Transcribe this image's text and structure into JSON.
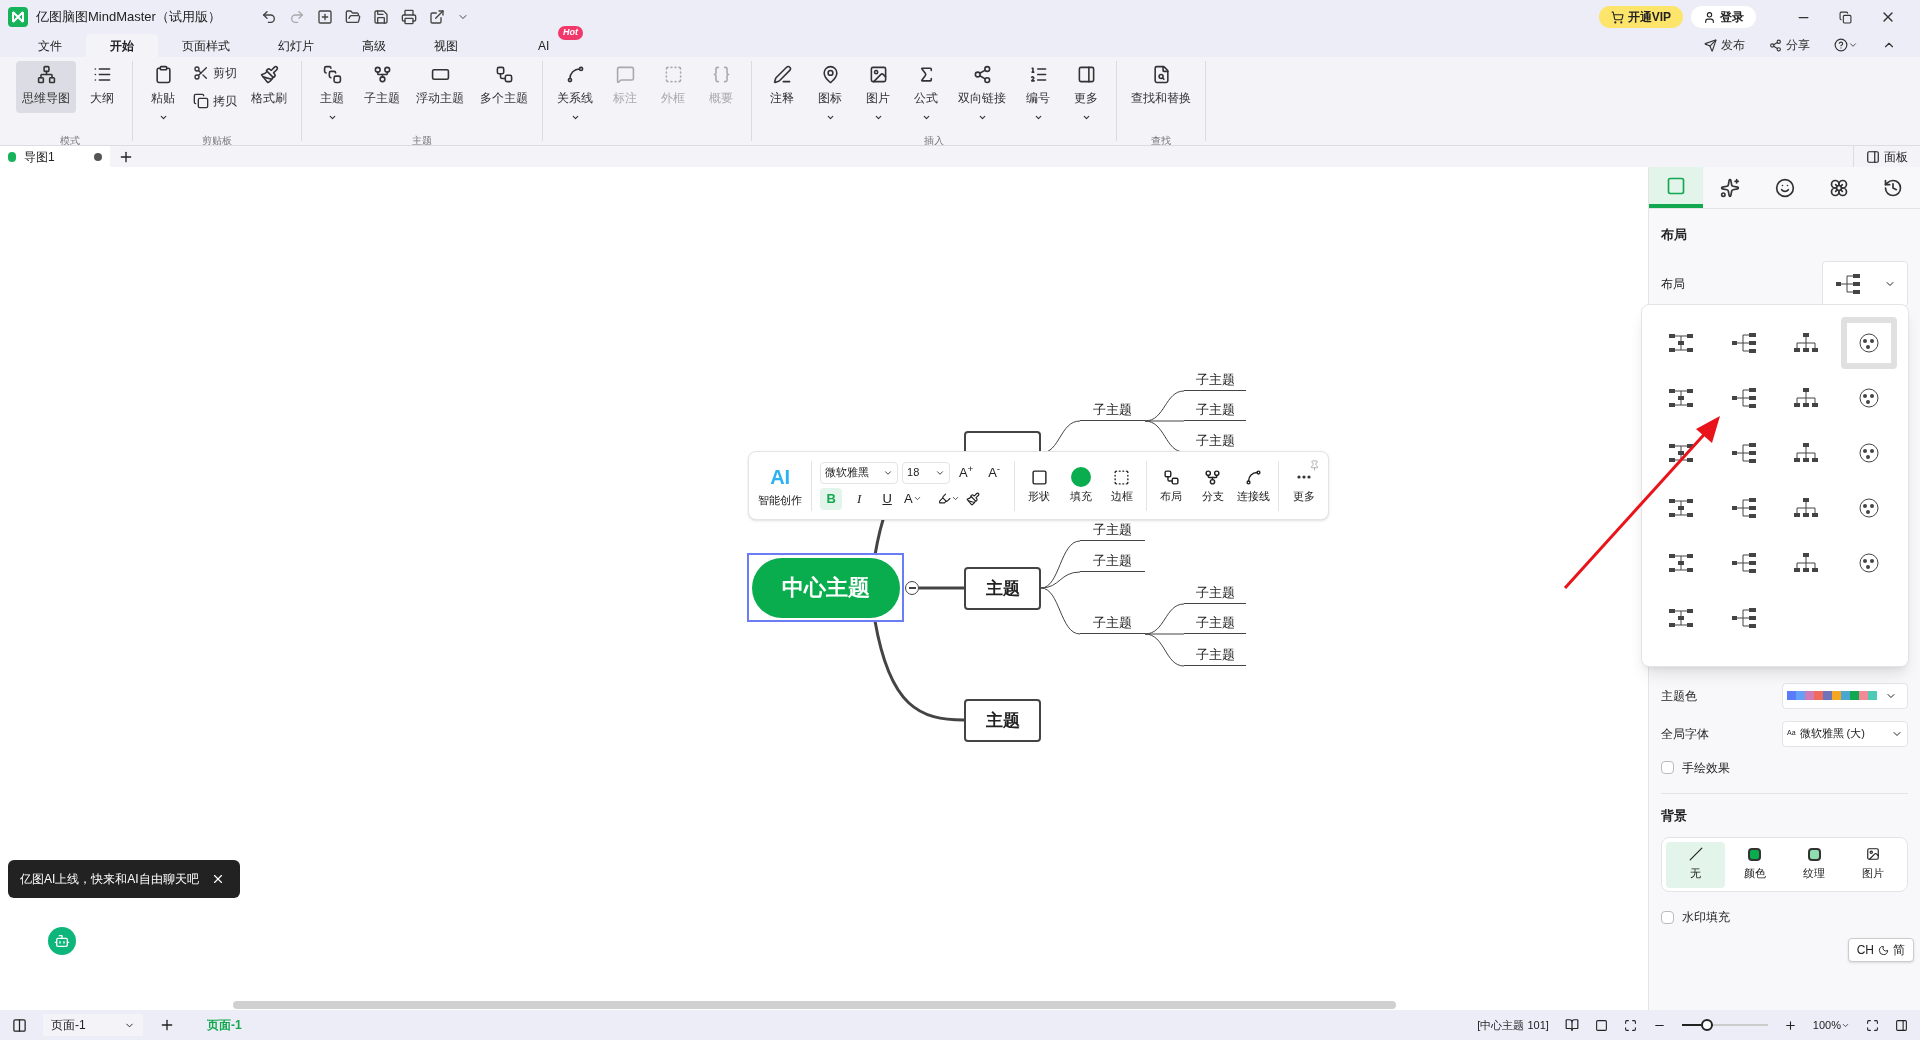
{
  "title_bar": {
    "title": "亿图脑图MindMaster（试用版）",
    "vip": "开通VIP",
    "login": "登录",
    "publish": "发布",
    "share": "分享"
  },
  "menu_tabs": [
    {
      "label": "文件",
      "selected": false
    },
    {
      "label": "开始",
      "selected": true
    },
    {
      "label": "页面样式",
      "selected": false
    },
    {
      "label": "幻灯片",
      "selected": false
    },
    {
      "label": "高级",
      "selected": false
    },
    {
      "label": "视图",
      "selected": false
    },
    {
      "label": "AI",
      "selected": false,
      "badge": "Hot"
    }
  ],
  "ribbon": [
    {
      "label": "模式",
      "items": [
        {
          "kind": "big",
          "label": "思维导图",
          "selected": true,
          "disabled": false,
          "dropdown": false
        },
        {
          "kind": "big",
          "label": "大纲",
          "selected": false,
          "disabled": false,
          "dropdown": false
        }
      ]
    },
    {
      "label": "剪贴板",
      "items": [
        {
          "kind": "big",
          "label": "粘贴",
          "selected": false,
          "disabled": false,
          "dropdown": true
        },
        {
          "kind": "small",
          "label": "剪切",
          "selected": false,
          "disabled": false
        },
        {
          "kind": "small",
          "label": "拷贝",
          "selected": false,
          "disabled": false
        },
        {
          "kind": "big",
          "label": "格式刷",
          "selected": false,
          "disabled": false,
          "dropdown": false
        }
      ]
    },
    {
      "label": "主题",
      "items": [
        {
          "kind": "big",
          "label": "主题",
          "selected": false,
          "disabled": false,
          "dropdown": true
        },
        {
          "kind": "big",
          "label": "子主题",
          "selected": false,
          "disabled": false,
          "dropdown": false
        },
        {
          "kind": "big",
          "label": "浮动主题",
          "selected": false,
          "disabled": false,
          "dropdown": false
        },
        {
          "kind": "big",
          "label": "多个主题",
          "selected": false,
          "disabled": false,
          "dropdown": false
        }
      ]
    },
    {
      "items": [
        {
          "kind": "big",
          "label": "关系线",
          "selected": false,
          "disabled": false,
          "dropdown": true
        },
        {
          "kind": "big",
          "label": "标注",
          "selected": false,
          "disabled": true,
          "dropdown": false
        },
        {
          "kind": "big",
          "label": "外框",
          "selected": false,
          "disabled": true,
          "dropdown": false
        },
        {
          "kind": "big",
          "label": "概要",
          "selected": false,
          "disabled": true,
          "dropdown": false
        }
      ]
    },
    {
      "label": "插入",
      "items": [
        {
          "kind": "big",
          "label": "注释",
          "selected": false,
          "disabled": false,
          "dropdown": false
        },
        {
          "kind": "big",
          "label": "图标",
          "selected": false,
          "disabled": false,
          "dropdown": true
        },
        {
          "kind": "big",
          "label": "图片",
          "selected": false,
          "disabled": false,
          "dropdown": true
        },
        {
          "kind": "big",
          "label": "公式",
          "selected": false,
          "disabled": false,
          "dropdown": true
        },
        {
          "kind": "big",
          "label": "双向链接",
          "selected": false,
          "disabled": false,
          "dropdown": true
        },
        {
          "kind": "big",
          "label": "编号",
          "selected": false,
          "disabled": false,
          "dropdown": true
        },
        {
          "kind": "big",
          "label": "更多",
          "selected": false,
          "disabled": false,
          "dropdown": true
        }
      ]
    },
    {
      "label": "查找",
      "items": [
        {
          "kind": "big",
          "label": "查找和替换",
          "selected": false,
          "disabled": false,
          "dropdown": false
        }
      ]
    }
  ],
  "doc_tabs": [
    {
      "label": "导图1",
      "selected": true,
      "unsaved": true
    }
  ],
  "panel_toggle": "面板",
  "mindmap": {
    "central": "中心主题",
    "topics": [
      {
        "children": [
          {
            "label": "子主题",
            "children": [
              {
                "label": "子主题"
              },
              {
                "label": "子主题"
              },
              {
                "label": "子主题"
              }
            ]
          }
        ]
      },
      {
        "label": "主题",
        "children": [
          {
            "label": "子主题"
          },
          {
            "label": "子主题"
          },
          {
            "label": "子主题",
            "children": [
              {
                "label": "子主题"
              },
              {
                "label": "子主题"
              },
              {
                "label": "子主题"
              }
            ]
          }
        ]
      },
      {
        "label": "主题"
      }
    ]
  },
  "float_toolbar": {
    "ai": "AI",
    "ai_label": "智能创作",
    "font": "微软雅黑",
    "size": "18",
    "grow": "A$^{+}$",
    "shrink": "A$^{-}$",
    "bold": "B",
    "bold_on": true,
    "italic": "I",
    "underline": "U",
    "font_color": "A",
    "tools": [
      {
        "label": "形状"
      },
      {
        "label": "填充"
      },
      {
        "label": "边框"
      },
      {
        "label": "布局"
      },
      {
        "label": "分支"
      },
      {
        "label": "连接线"
      },
      {
        "label": "更多"
      }
    ]
  },
  "ai_tip": {
    "text": "亿图AI上线，快来和AI自由聊天吧"
  },
  "panel": {
    "tabs": [
      {
        "selected": true
      },
      {
        "selected": false
      },
      {
        "selected": false
      },
      {
        "selected": false
      },
      {
        "selected": false
      }
    ],
    "section": "布局",
    "layout_label": "布局",
    "layouts": [
      {
        "selected": false
      },
      {
        "selected": false
      },
      {
        "selected": false
      },
      {
        "selected": true
      },
      {
        "selected": false
      },
      {
        "selected": false
      },
      {
        "selected": false
      },
      {
        "selected": false
      },
      {
        "selected": false
      },
      {
        "selected": false
      },
      {
        "selected": false
      },
      {
        "selected": false
      },
      {
        "selected": false
      },
      {
        "selected": false
      },
      {
        "selected": false
      },
      {
        "selected": false
      },
      {
        "selected": false
      },
      {
        "selected": false
      },
      {
        "selected": false
      },
      {
        "selected": false
      },
      {
        "selected": false
      },
      {
        "selected": false
      }
    ],
    "theme_color_label": "主题色",
    "theme_colors": [
      {
        "color": "#5b7cfa"
      },
      {
        "color": "#64a0f5"
      },
      {
        "color": "#d07bb5"
      },
      {
        "color": "#ee6a5c"
      },
      {
        "color": "#6f73b8"
      },
      {
        "color": "#f5a623"
      },
      {
        "color": "#4aa8d0"
      },
      {
        "color": "#12a84f"
      },
      {
        "color": "#f28b95"
      },
      {
        "color": "#4ccab4"
      }
    ],
    "font_label": "全局字体",
    "font_prefix": "Aa",
    "font_value": "微软雅黑 (大)",
    "hand_drawn": {
      "label": "手绘效果",
      "checked": false
    },
    "background": "背景",
    "bg_options": [
      {
        "label": "无",
        "selected": true
      },
      {
        "label": "颜色",
        "selected": false
      },
      {
        "label": "纹理",
        "selected": false
      },
      {
        "label": "图片",
        "selected": false
      }
    ],
    "watermark": {
      "label": "水印填充",
      "checked": false
    },
    "ime": {
      "lang": "CH",
      "mode": "简"
    }
  },
  "status_bar": {
    "page_select": "页面-1",
    "pages": [
      {
        "label": "页面-1",
        "selected": true
      }
    ],
    "info": "[中心主题 101]",
    "zoom": {
      "level": 0.22
    },
    "zoom_text": "100%"
  }
}
